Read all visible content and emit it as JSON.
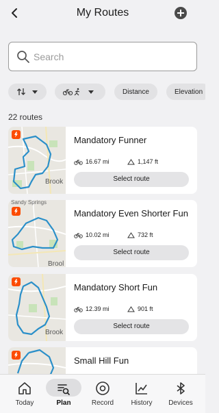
{
  "header": {
    "title": "My Routes",
    "back_icon": "chevron-left-icon",
    "add_icon": "plus-circle-icon"
  },
  "search": {
    "placeholder": "Search",
    "value": ""
  },
  "filters": [
    {
      "label": "",
      "icon": "sort-arrows-icon",
      "dropdown": true
    },
    {
      "label": "",
      "icon": "bike-run-icon",
      "dropdown": true
    },
    {
      "label": "Distance",
      "dropdown": false
    },
    {
      "label": "Elevation",
      "dropdown": false
    }
  ],
  "routes_count": "22 routes",
  "routes": [
    {
      "name": "Mandatory Funner",
      "distance": "16.67 mi",
      "elevation": "1,147 ft",
      "action": "Select route",
      "map_label": "Brook"
    },
    {
      "name": "Mandatory Even Shorter Fun",
      "distance": "10.02 mi",
      "elevation": "732 ft",
      "action": "Select route",
      "map_label": "Brool",
      "map_label_top": "Sandy Springs"
    },
    {
      "name": "Mandatory Short Fun",
      "distance": "12.39 mi",
      "elevation": "901 ft",
      "action": "Select route",
      "map_label": "Brook"
    },
    {
      "name": "Small Hill Fun",
      "distance": "",
      "elevation": "",
      "action": "",
      "map_label": ""
    }
  ],
  "tabs": [
    {
      "label": "Today",
      "icon": "home-icon",
      "active": false
    },
    {
      "label": "Plan",
      "icon": "route-plan-icon",
      "active": true
    },
    {
      "label": "Record",
      "icon": "record-icon",
      "active": false
    },
    {
      "label": "History",
      "icon": "history-chart-icon",
      "active": false
    },
    {
      "label": "Devices",
      "icon": "bluetooth-icon",
      "active": false
    }
  ],
  "colors": {
    "accent": "#fc4c02",
    "route_line": "#2a8fc9",
    "background": "#f1f1f3"
  }
}
